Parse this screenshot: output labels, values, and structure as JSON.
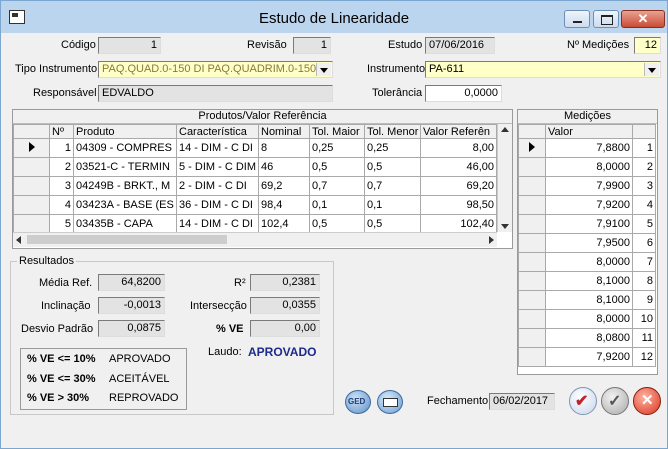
{
  "window": {
    "title": "Estudo de Linearidade"
  },
  "header": {
    "codigo_label": "Código",
    "codigo_value": "1",
    "revisao_label": "Revisão",
    "revisao_value": "1",
    "estudo_label": "Estudo",
    "estudo_value": "07/06/2016",
    "medicoes_label": "Nº Medições",
    "medicoes_value": "12",
    "tipo_label": "Tipo Instrumento",
    "tipo_value": "PAQ.QUAD.0-150 DI   PAQ.QUADRIM.0-150 DI",
    "instrumento_label": "Instrumento",
    "instrumento_value": "PA-611",
    "responsavel_label": "Responsável",
    "responsavel_value": "EDVALDO",
    "tolerancia_label": "Tolerância",
    "tolerancia_value": "0,0000"
  },
  "produtos": {
    "title": "Produtos/Valor Referência",
    "columns": [
      "Nº",
      "Produto",
      "Característica",
      "Nominal",
      "Tol. Maior",
      "Tol. Menor",
      "Valor Referên"
    ],
    "rows": [
      {
        "n": "1",
        "produto": "04309 - COMPRES",
        "carac": "14 - DIM - C DI",
        "nominal": "8",
        "tmaior": "0,25",
        "tmenor": "0,25",
        "valor": "8,00"
      },
      {
        "n": "2",
        "produto": "03521-C - TERMIN",
        "carac": "5 - DIM - C DIM",
        "nominal": "46",
        "tmaior": "0,5",
        "tmenor": "0,5",
        "valor": "46,00"
      },
      {
        "n": "3",
        "produto": "04249B - BRKT., M",
        "carac": "2 - DIM - C DI",
        "nominal": "69,2",
        "tmaior": "0,7",
        "tmenor": "0,7",
        "valor": "69,20"
      },
      {
        "n": "4",
        "produto": "03423A - BASE (ES",
        "carac": "36 - DIM - C DI",
        "nominal": "98,4",
        "tmaior": "0,1",
        "tmenor": "0,1",
        "valor": "98,50"
      },
      {
        "n": "5",
        "produto": "03435B - CAPA",
        "carac": "14 - DIM - C DI",
        "nominal": "102,4",
        "tmaior": "0,5",
        "tmenor": "0,5",
        "valor": "102,40"
      }
    ]
  },
  "medicoes": {
    "title": "Medições",
    "col_valor": "Valor",
    "rows": [
      {
        "v": "7,8800",
        "n": "1"
      },
      {
        "v": "8,0000",
        "n": "2"
      },
      {
        "v": "7,9900",
        "n": "3"
      },
      {
        "v": "7,9200",
        "n": "4"
      },
      {
        "v": "7,9100",
        "n": "5"
      },
      {
        "v": "7,9500",
        "n": "6"
      },
      {
        "v": "8,0000",
        "n": "7"
      },
      {
        "v": "8,1000",
        "n": "8"
      },
      {
        "v": "8,1000",
        "n": "9"
      },
      {
        "v": "8,0000",
        "n": "10"
      },
      {
        "v": "8,0800",
        "n": "11"
      },
      {
        "v": "7,9200",
        "n": "12"
      }
    ]
  },
  "resultados": {
    "title": "Resultados",
    "media_label": "Média Ref.",
    "media_value": "64,8200",
    "r2_label": "R²",
    "r2_value": "0,2381",
    "inclinacao_label": "Inclinação",
    "inclinacao_value": "-0,0013",
    "interseccao_label": "Intersecção",
    "interseccao_value": "0,0355",
    "desvio_label": "Desvio Padrão",
    "desvio_value": "0,0875",
    "ve_label": "% VE",
    "ve_value": "0,00",
    "laudo_label": "Laudo:",
    "laudo_value": "APROVADO",
    "legend": [
      {
        "crit": "% VE <= 10%",
        "status": "APROVADO"
      },
      {
        "crit": "% VE <= 30%",
        "status": "ACEITÁVEL"
      },
      {
        "crit": "% VE  > 30%",
        "status": "REPROVADO"
      }
    ]
  },
  "footer": {
    "fechamento_label": "Fechamento",
    "fechamento_value": "06/02/2017",
    "ged_label": "GED"
  },
  "colors": {
    "laudo": "#1b2a8c",
    "yellow_field": "#ffffc8",
    "title_bar": "#bcd5ee"
  }
}
